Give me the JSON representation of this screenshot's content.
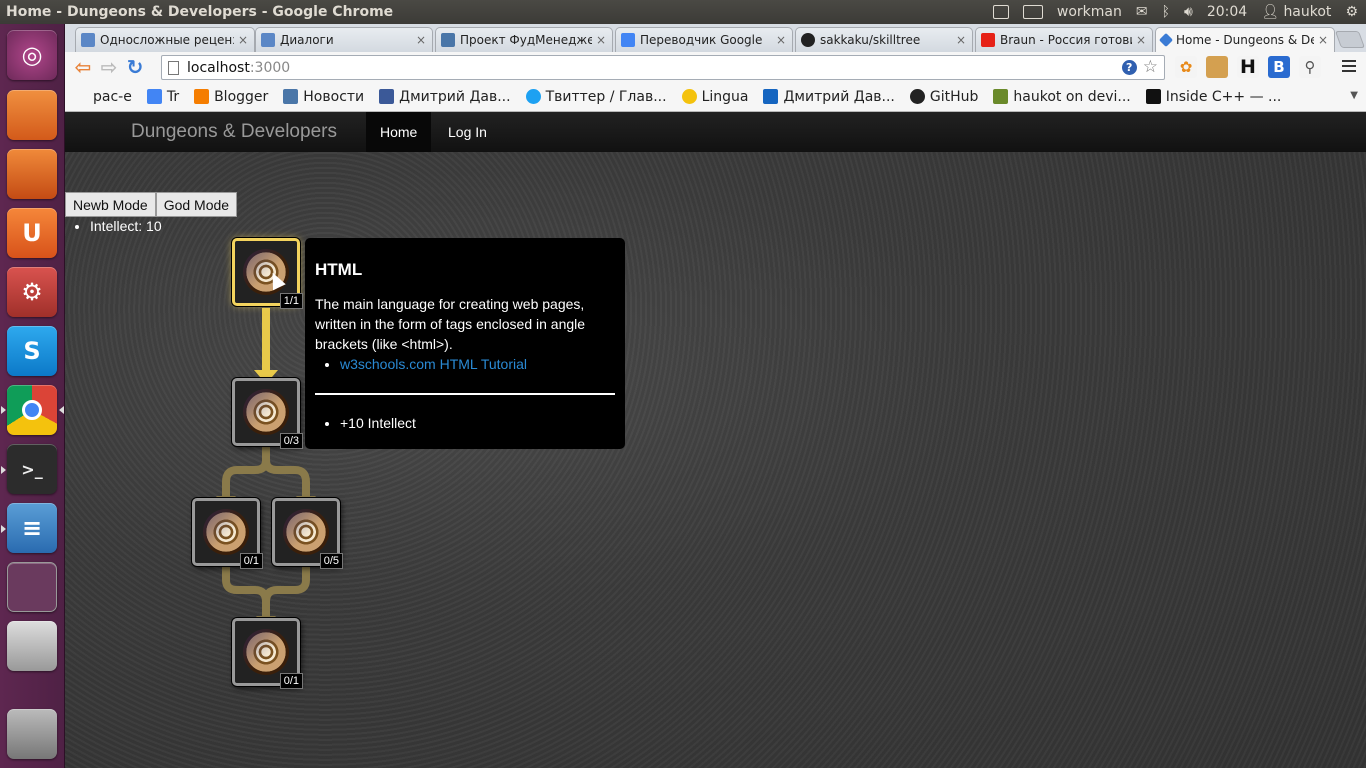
{
  "window": {
    "title": "Home - Dungeons & Developers - Google Chrome"
  },
  "system_indicators": {
    "user_session": "workman",
    "time": "20:04",
    "username": "haukot"
  },
  "launcher": {
    "items": [
      "ubuntu-icon",
      "files-icon",
      "software-center-icon",
      "ubuntu-one-icon",
      "system-settings-icon",
      "skype-icon",
      "chrome-icon",
      "terminal-icon",
      "writer-icon",
      "workspace-switcher-icon",
      "drive-icon",
      "trash-icon"
    ]
  },
  "tabs": [
    {
      "label": "Односложные реценз",
      "close": "×"
    },
    {
      "label": "Диалоги",
      "close": "×"
    },
    {
      "label": "Проект ФудМенеджер",
      "close": "×"
    },
    {
      "label": "Переводчик Google",
      "close": "×"
    },
    {
      "label": "sakkaku/skilltree",
      "close": "×"
    },
    {
      "label": "Braun - Россия готови",
      "close": "×"
    },
    {
      "label": "Home - Dungeons & De",
      "close": "×"
    }
  ],
  "address_bar": {
    "host": "localhost",
    "port": ":3000"
  },
  "bookmarks": [
    {
      "label": "рас-е"
    },
    {
      "label": "Tr"
    },
    {
      "label": "Blogger"
    },
    {
      "label": "Новости"
    },
    {
      "label": "Дмитрий Дав..."
    },
    {
      "label": "Твиттер / Глав..."
    },
    {
      "label": "Lingua"
    },
    {
      "label": "Дмитрий Дав..."
    },
    {
      "label": "GitHub"
    },
    {
      "label": "haukot on devi..."
    },
    {
      "label": "Inside C++ — ..."
    }
  ],
  "site": {
    "brand": "Dungeons & Developers",
    "nav": {
      "home": "Home",
      "login": "Log In"
    },
    "modes": {
      "newb": "Newb Mode",
      "god": "God Mode"
    },
    "stats": [
      "Intellect: 10"
    ],
    "skills": [
      {
        "count": "1/1",
        "active": true
      },
      {
        "count": "0/3",
        "active": false
      },
      {
        "count": "0/1",
        "active": false
      },
      {
        "count": "0/5",
        "active": false
      },
      {
        "count": "0/1",
        "active": false
      }
    ],
    "tooltip": {
      "title": "HTML",
      "description": "The main language for creating web pages, written in the form of tags enclosed in angle brackets (like <html>).",
      "link": "w3schools.com HTML Tutorial",
      "bonus": "+10 Intellect"
    }
  },
  "colors": {
    "launcher": "#5e2750",
    "accent_gold": "#f4d45e",
    "link": "#2a8ad4"
  }
}
